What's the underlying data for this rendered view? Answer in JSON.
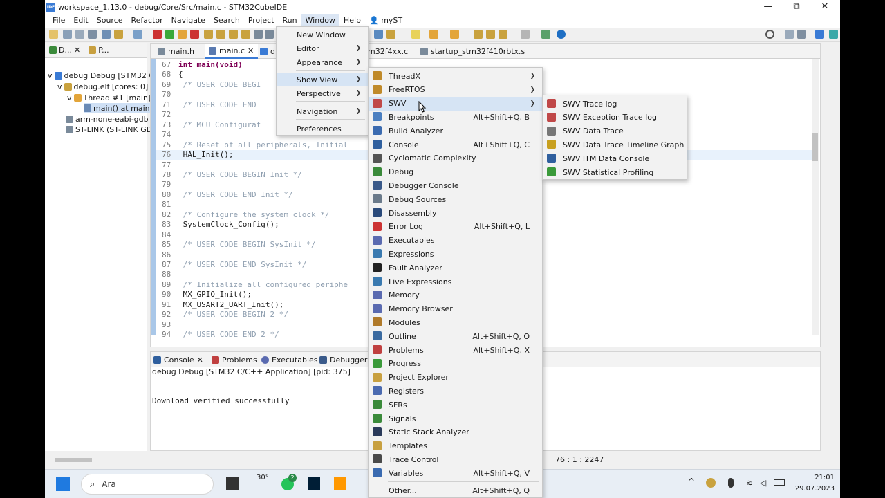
{
  "window": {
    "title": "workspace_1.13.0 - debug/Core/Src/main.c - STM32CubeIDE",
    "ide_badge": "IDE",
    "minimize": "—",
    "restore": "⧉",
    "close": "✕"
  },
  "menubar": [
    "File",
    "Edit",
    "Source",
    "Refactor",
    "Navigate",
    "Search",
    "Project",
    "Run",
    "Window",
    "Help"
  ],
  "menubar_user": "myST",
  "left_panel": {
    "tab1": "D...",
    "tab2": "P...",
    "tree": [
      "debug Debug [STM32 C",
      "debug.elf [cores: 0]",
      "Thread #1 [main]",
      "main() at main.",
      "arm-none-eabi-gdb (",
      "ST-LINK (ST-LINK GD"
    ]
  },
  "editor": {
    "tabs": [
      "main.h",
      "main.c",
      "d",
      "m32f4xx.c",
      "startup_stm32f410rbtx.s"
    ],
    "lines": [
      {
        "n": "67",
        "code": "int main(void)",
        "kind": "kw"
      },
      {
        "n": "68",
        "code": "{",
        "kind": "plain"
      },
      {
        "n": "69",
        "code": "  /* USER CODE BEGI",
        "kind": "cm"
      },
      {
        "n": "70",
        "code": "",
        "kind": "plain"
      },
      {
        "n": "71",
        "code": "  /* USER CODE END ",
        "kind": "cm"
      },
      {
        "n": "72",
        "code": "",
        "kind": "plain"
      },
      {
        "n": "73",
        "code": "  /* MCU Configurat",
        "kind": "cm"
      },
      {
        "n": "74",
        "code": "",
        "kind": "plain"
      },
      {
        "n": "75",
        "code": "  /* Reset of all peripherals, Initial",
        "kind": "cm"
      },
      {
        "n": "76",
        "code": "  HAL_Init();",
        "kind": "plain"
      },
      {
        "n": "77",
        "code": "",
        "kind": "plain"
      },
      {
        "n": "78",
        "code": "  /* USER CODE BEGIN Init */",
        "kind": "cm"
      },
      {
        "n": "79",
        "code": "",
        "kind": "plain"
      },
      {
        "n": "80",
        "code": "  /* USER CODE END Init */",
        "kind": "cm"
      },
      {
        "n": "81",
        "code": "",
        "kind": "plain"
      },
      {
        "n": "82",
        "code": "  /* Configure the system clock */",
        "kind": "cm"
      },
      {
        "n": "83",
        "code": "  SystemClock_Config();",
        "kind": "plain"
      },
      {
        "n": "84",
        "code": "",
        "kind": "plain"
      },
      {
        "n": "85",
        "code": "  /* USER CODE BEGIN SysInit */",
        "kind": "cm"
      },
      {
        "n": "86",
        "code": "",
        "kind": "plain"
      },
      {
        "n": "87",
        "code": "  /* USER CODE END SysInit */",
        "kind": "cm"
      },
      {
        "n": "88",
        "code": "",
        "kind": "plain"
      },
      {
        "n": "89",
        "code": "  /* Initialize all configured periphe",
        "kind": "cm"
      },
      {
        "n": "90",
        "code": "  MX_GPIO_Init();",
        "kind": "plain"
      },
      {
        "n": "91",
        "code": "  MX_USART2_UART_Init();",
        "kind": "plain"
      },
      {
        "n": "92",
        "code": "  /* USER CODE BEGIN 2 */",
        "kind": "cm"
      },
      {
        "n": "93",
        "code": "",
        "kind": "plain"
      },
      {
        "n": "94",
        "code": "  /* USER CODE END 2 */",
        "kind": "cm"
      }
    ]
  },
  "console": {
    "tabs": [
      "Console",
      "Problems",
      "Executables",
      "Debugger C"
    ],
    "header": "debug Debug [STM32 C/C++ Application]  [pid: 375]",
    "output": "Download verified successfully"
  },
  "status": {
    "position": "76 : 1 : 2247"
  },
  "window_menu": [
    {
      "label": "New Window",
      "arrow": false
    },
    {
      "label": "Editor",
      "arrow": true
    },
    {
      "label": "Appearance",
      "arrow": true
    },
    {
      "label": "Show View",
      "arrow": true
    },
    {
      "label": "Perspective",
      "arrow": true
    },
    {
      "label": "Navigation",
      "arrow": true
    },
    {
      "label": "Preferences",
      "arrow": false
    }
  ],
  "show_view_menu": [
    {
      "label": "ThreadX",
      "accel": "",
      "arrow": true,
      "color": "#c08a2a"
    },
    {
      "label": "FreeRTOS",
      "accel": "",
      "arrow": true,
      "color": "#c08a2a"
    },
    {
      "label": "SWV",
      "accel": "",
      "arrow": true,
      "color": "#c04848"
    },
    {
      "label": "Breakpoints",
      "accel": "Alt+Shift+Q, B",
      "arrow": false,
      "color": "#4a7fc1"
    },
    {
      "label": "Build Analyzer",
      "accel": "",
      "arrow": false,
      "color": "#3b6bb0"
    },
    {
      "label": "Console",
      "accel": "Alt+Shift+Q, C",
      "arrow": false,
      "color": "#2f5f9e"
    },
    {
      "label": "Cyclomatic Complexity",
      "accel": "",
      "arrow": false,
      "color": "#555555"
    },
    {
      "label": "Debug",
      "accel": "",
      "arrow": false,
      "color": "#3a8a3a"
    },
    {
      "label": "Debugger Console",
      "accel": "",
      "arrow": false,
      "color": "#3a5a8a"
    },
    {
      "label": "Debug Sources",
      "accel": "",
      "arrow": false,
      "color": "#6a7a8a"
    },
    {
      "label": "Disassembly",
      "accel": "",
      "arrow": false,
      "color": "#2a4a7a"
    },
    {
      "label": "Error Log",
      "accel": "Alt+Shift+Q, L",
      "arrow": false,
      "color": "#cc3333"
    },
    {
      "label": "Executables",
      "accel": "",
      "arrow": false,
      "color": "#5a6ab0"
    },
    {
      "label": "Expressions",
      "accel": "",
      "arrow": false,
      "color": "#3a7ab0"
    },
    {
      "label": "Fault Analyzer",
      "accel": "",
      "arrow": false,
      "color": "#222222"
    },
    {
      "label": "Live Expressions",
      "accel": "",
      "arrow": false,
      "color": "#3a7ab0"
    },
    {
      "label": "Memory",
      "accel": "",
      "arrow": false,
      "color": "#5a6ab0"
    },
    {
      "label": "Memory Browser",
      "accel": "",
      "arrow": false,
      "color": "#5a6ab0"
    },
    {
      "label": "Modules",
      "accel": "",
      "arrow": false,
      "color": "#b07a2a"
    },
    {
      "label": "Outline",
      "accel": "Alt+Shift+Q, O",
      "arrow": false,
      "color": "#3a6aa0"
    },
    {
      "label": "Problems",
      "accel": "Alt+Shift+Q, X",
      "arrow": false,
      "color": "#c04040"
    },
    {
      "label": "Progress",
      "accel": "",
      "arrow": false,
      "color": "#3a9a3a"
    },
    {
      "label": "Project Explorer",
      "accel": "",
      "arrow": false,
      "color": "#c8a040"
    },
    {
      "label": "Registers",
      "accel": "",
      "arrow": false,
      "color": "#4a6ab0"
    },
    {
      "label": "SFRs",
      "accel": "",
      "arrow": false,
      "color": "#3a8a3a"
    },
    {
      "label": "Signals",
      "accel": "",
      "arrow": false,
      "color": "#3a8a3a"
    },
    {
      "label": "Static Stack Analyzer",
      "accel": "",
      "arrow": false,
      "color": "#2a3a5a"
    },
    {
      "label": "Templates",
      "accel": "",
      "arrow": false,
      "color": "#c8a040"
    },
    {
      "label": "Trace Control",
      "accel": "",
      "arrow": false,
      "color": "#4a4a4a"
    },
    {
      "label": "Variables",
      "accel": "Alt+Shift+Q, V",
      "arrow": false,
      "color": "#3a6ab0"
    },
    {
      "label": "Other...",
      "accel": "Alt+Shift+Q, Q",
      "arrow": false,
      "color": ""
    }
  ],
  "swv_menu": [
    {
      "label": "SWV Trace log",
      "color": "#c04848"
    },
    {
      "label": "SWV Exception Trace log",
      "color": "#c04848"
    },
    {
      "label": "SWV Data Trace",
      "color": "#777777"
    },
    {
      "label": "SWV Data Trace Timeline Graph",
      "color": "#c8a020"
    },
    {
      "label": "SWV ITM Data Console",
      "color": "#2f5f9e"
    },
    {
      "label": "SWV Statistical Profiling",
      "color": "#3a9a3a"
    }
  ],
  "taskbar": {
    "search": "Ara",
    "weather": "30°",
    "time": "21:01",
    "date": "29.07.2023",
    "badge": "2"
  }
}
